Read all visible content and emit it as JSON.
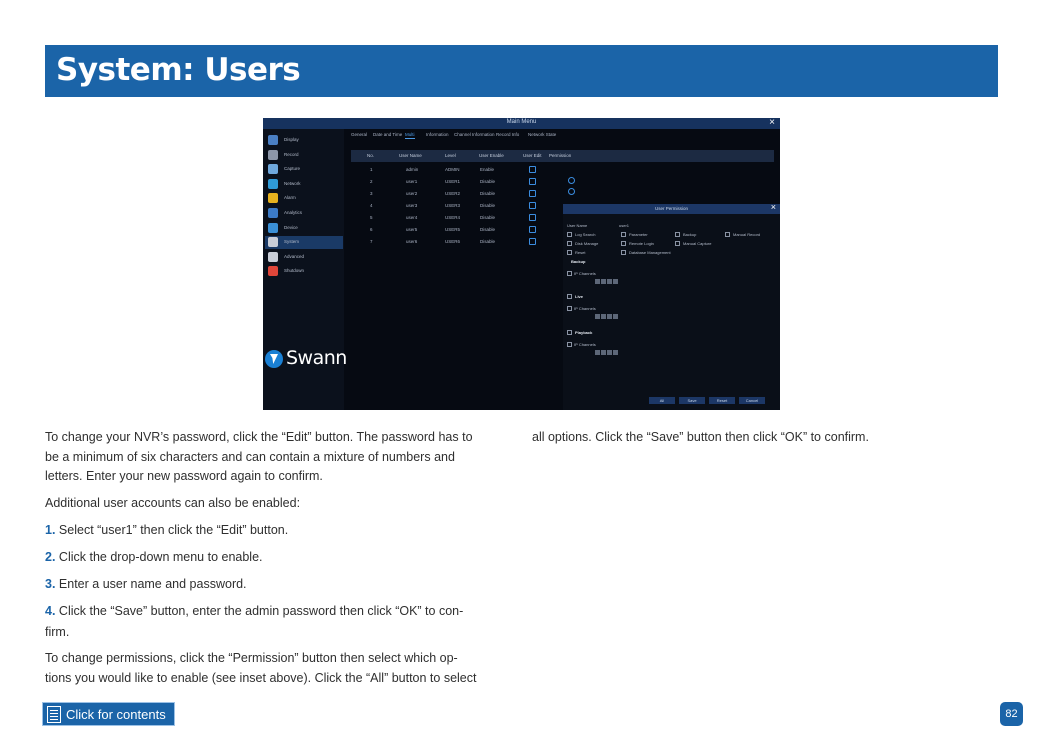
{
  "page": {
    "title": "System: Users",
    "page_number": "82",
    "contents_link": "Click for contents"
  },
  "screenshot": {
    "window_title": "Main Menu",
    "sidebar": [
      {
        "label": "Display",
        "icon": "display-icon",
        "color": "#4a7fc4"
      },
      {
        "label": "Record",
        "icon": "record-icon",
        "color": "#8c96a8"
      },
      {
        "label": "Capture",
        "icon": "camera-icon",
        "color": "#6fa8dc"
      },
      {
        "label": "Network",
        "icon": "network-icon",
        "color": "#2f9bd8"
      },
      {
        "label": "Alarm",
        "icon": "alarm-icon",
        "color": "#e7b21f"
      },
      {
        "label": "Analytics",
        "icon": "analytics-icon",
        "color": "#3c7bc7"
      },
      {
        "label": "Device",
        "icon": "device-icon",
        "color": "#3a8fd6"
      },
      {
        "label": "System",
        "icon": "system-icon",
        "color": "#c9ced8"
      },
      {
        "label": "Advanced",
        "icon": "advanced-icon",
        "color": "#c9ced8"
      },
      {
        "label": "Shutdown",
        "icon": "power-icon",
        "color": "#e0463a"
      }
    ],
    "logo": "Swann",
    "tabs": [
      "General",
      "Date and Time",
      "Multi",
      "Information",
      "Channel Information",
      "Record Info",
      "Network State"
    ],
    "active_tab": 2,
    "table_headers": [
      "No.",
      "User Name",
      "Level",
      "User Enable",
      "User Edit",
      "Permission"
    ],
    "rows": [
      {
        "no": "1",
        "name": "admin",
        "level": "ADMIN",
        "enable": "Enable"
      },
      {
        "no": "2",
        "name": "user1",
        "level": "USER1",
        "enable": "Disable"
      },
      {
        "no": "3",
        "name": "user2",
        "level": "USER2",
        "enable": "Disable"
      },
      {
        "no": "4",
        "name": "user3",
        "level": "USER3",
        "enable": "Disable"
      },
      {
        "no": "5",
        "name": "user4",
        "level": "USER4",
        "enable": "Disable"
      },
      {
        "no": "6",
        "name": "user5",
        "level": "USER5",
        "enable": "Disable"
      },
      {
        "no": "7",
        "name": "user6",
        "level": "USER6",
        "enable": "Disable"
      }
    ],
    "dialog": {
      "title": "User Permission",
      "user_name_label": "User Name",
      "user_name_value": "user1",
      "permissions": [
        "Log Search",
        "Parameter",
        "Backup",
        "Manual Record",
        "Disk Manage",
        "Remote Login",
        "Manual Capture",
        "Reset",
        "Database Management"
      ],
      "sections": [
        "Backup",
        "Live",
        "Playback"
      ],
      "channels_label": "IP Channels",
      "buttons": [
        "All",
        "Save",
        "Reset",
        "Cancel"
      ]
    }
  },
  "text": {
    "col1": [
      "To change your NVR’s password, click the “Edit” button. The password has to",
      "be a minimum of six characters and can contain a mixture of numbers and",
      "letters. Enter your new password again to confirm."
    ],
    "additional": "Additional user accounts can also be enabled:",
    "steps": [
      {
        "num": "1.",
        "text": "Select “user1” then click the “Edit” button."
      },
      {
        "num": "2.",
        "text": "Click the drop-down menu to enable."
      },
      {
        "num": "3.",
        "text": "Enter a user name and password."
      },
      {
        "num": "4.",
        "text": "Click the “Save” button, enter the admin password then click “OK” to con-"
      }
    ],
    "step4_cont": "firm.",
    "perm_para": [
      "To change permissions, click the “Permission” button then select which op-",
      "tions you would like to enable (see inset above). Click the “All” button to select"
    ],
    "col2": "all options. Click the “Save” button then click “OK” to confirm."
  }
}
